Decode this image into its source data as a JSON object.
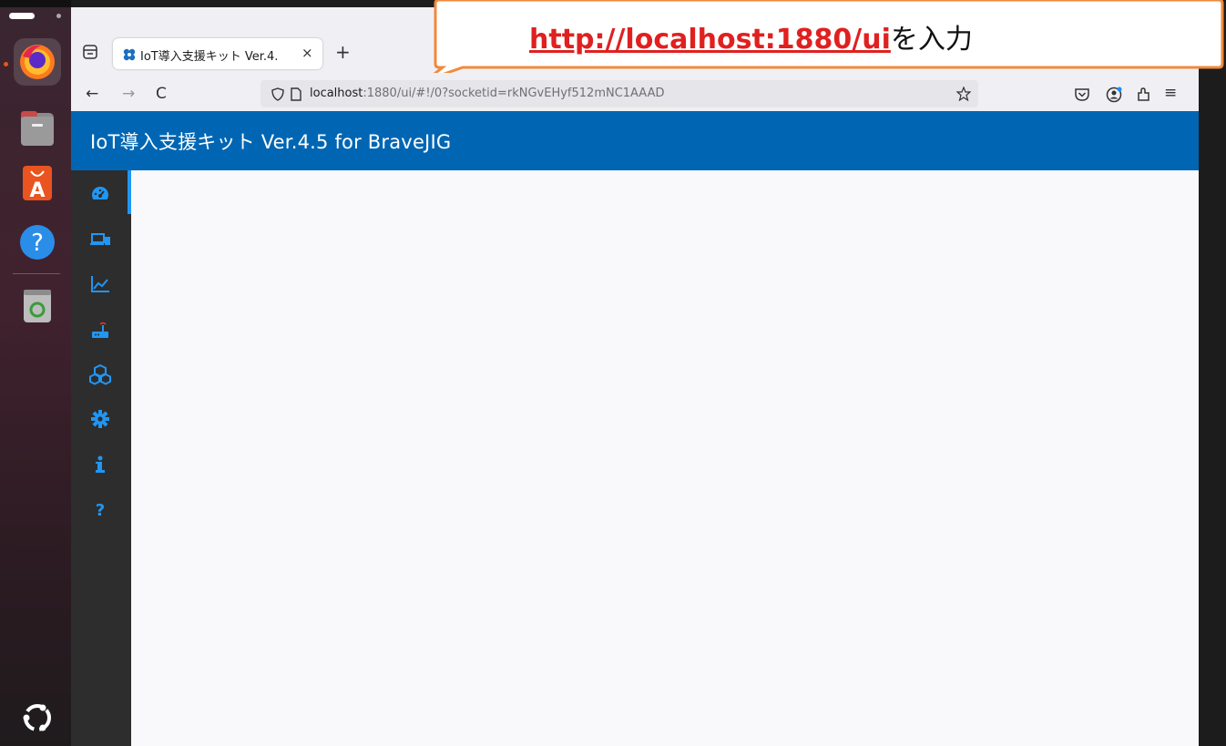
{
  "dock": {
    "apps": [
      {
        "name": "firefox",
        "running": true
      },
      {
        "name": "files"
      },
      {
        "name": "app-center"
      },
      {
        "name": "help"
      },
      {
        "name": "trash"
      }
    ],
    "bottom": "ubuntu-logo"
  },
  "browser": {
    "tab": {
      "title": "IoT導入支援キット Ver.4.",
      "close": "×"
    },
    "new_tab": "+",
    "nav": {
      "back": "←",
      "forward": "→",
      "reload": "C"
    },
    "url": {
      "host": "localhost",
      "rest": ":1880/ui/#!/0?socketid=rkNGvEHyf512mNC1AAAD"
    },
    "menu": "≡"
  },
  "dashboard": {
    "header_title": "IoT導入支援キット Ver.4.5 for BraveJIG",
    "accent": "#0066b3",
    "sidebar_icons": [
      "dashboard-icon",
      "devices-icon",
      "chart-icon",
      "router-icon",
      "cubes-icon",
      "settings-icon",
      "info-icon",
      "help-icon"
    ],
    "active_index": 0
  },
  "callout": {
    "link": "http://localhost:1880/ui",
    "suffix": "を入力"
  }
}
